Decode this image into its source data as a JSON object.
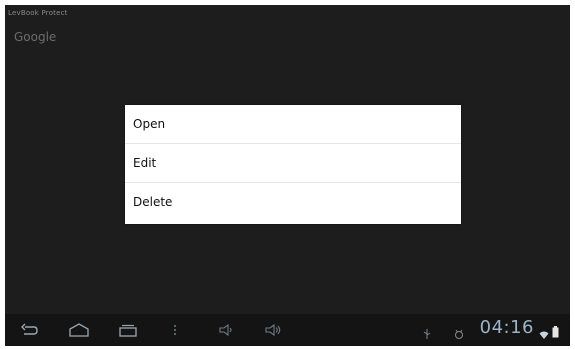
{
  "app": {
    "title": "LevBook Protect",
    "item_label": "Google"
  },
  "context_menu": {
    "items": [
      {
        "label": "Open"
      },
      {
        "label": "Edit"
      },
      {
        "label": "Delete"
      }
    ]
  },
  "system_bar": {
    "clock": "04:16",
    "icons": [
      "back-icon",
      "home-icon",
      "recent-apps-icon",
      "menu-icon",
      "volume-down-icon",
      "volume-up-icon",
      "usb-icon",
      "debug-icon",
      "wifi-icon",
      "battery-icon"
    ]
  },
  "colors": {
    "screen_bg": "#1d1d1d",
    "menu_bg": "#ffffff",
    "clock": "#9bb4c8"
  }
}
